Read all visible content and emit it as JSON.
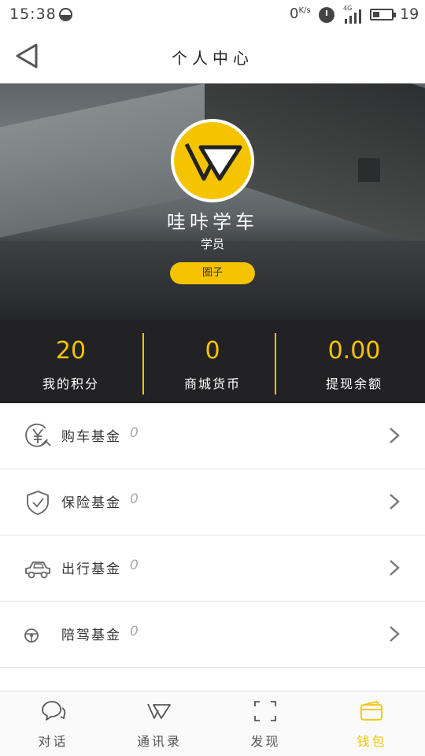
{
  "status_bar": {
    "time": "15:38",
    "network_speed": "0",
    "network_speed_unit": "K/s",
    "signal_type": "4G",
    "battery_level": "19"
  },
  "header": {
    "title": "个人中心"
  },
  "profile": {
    "name": "哇咔学车",
    "role": "学员",
    "tag_button": "圈子"
  },
  "stats": [
    {
      "value": "20",
      "label": "我的积分"
    },
    {
      "value": "0",
      "label": "商城货币"
    },
    {
      "value": "0.00",
      "label": "提现余额"
    }
  ],
  "funds": [
    {
      "icon": "yen-coin-icon",
      "label": "购车基金",
      "amount": "0"
    },
    {
      "icon": "shield-check-icon",
      "label": "保险基金",
      "amount": "0"
    },
    {
      "icon": "car-icon",
      "label": "出行基金",
      "amount": "0"
    },
    {
      "icon": "steering-wheel-icon",
      "label": "陪驾基金",
      "amount": "0"
    }
  ],
  "tabs": [
    {
      "icon": "chat-bubbles-icon",
      "label": "对话",
      "active": false
    },
    {
      "icon": "wakka-logo-icon",
      "label": "通讯录",
      "active": false
    },
    {
      "icon": "scan-frame-icon",
      "label": "发现",
      "active": false
    },
    {
      "icon": "wallet-icon",
      "label": "钱包",
      "active": true
    }
  ],
  "colors": {
    "accent": "#f5c400",
    "stats_background": "#222224",
    "text_dark": "#333333"
  }
}
